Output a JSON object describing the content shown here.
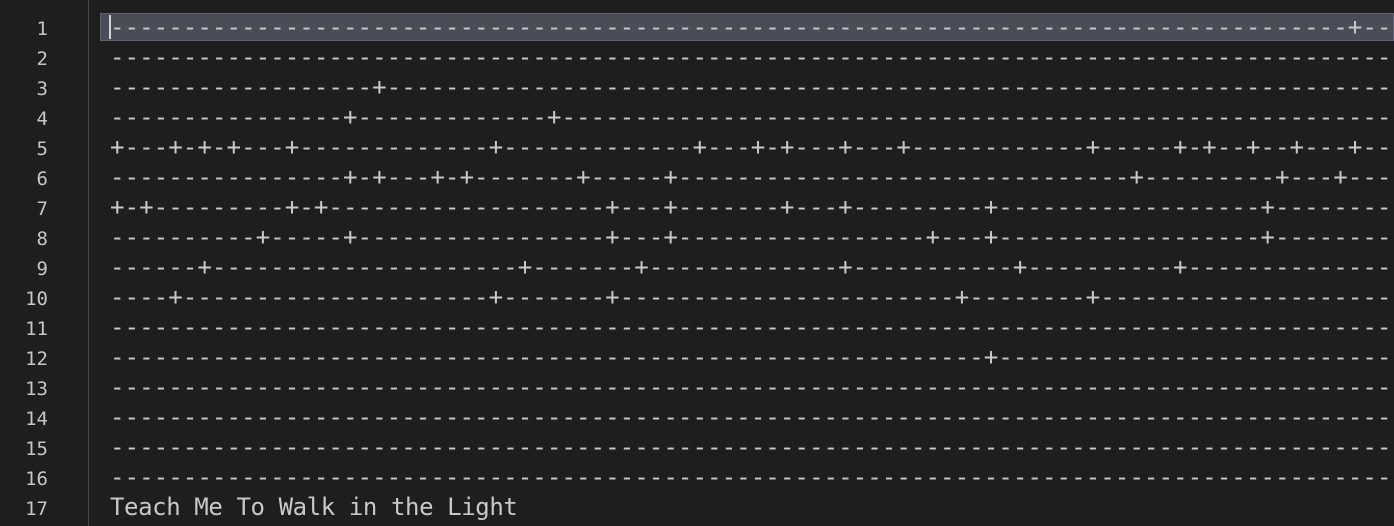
{
  "editor": {
    "line_numbers": [
      "1",
      "2",
      "3",
      "4",
      "5",
      "6",
      "7",
      "8",
      "9",
      "10",
      "11",
      "12",
      "13",
      "14",
      "15",
      "16",
      "17"
    ],
    "lines": [
      "-------------------------------------------------------------------------------------+--",
      "----------------------------------------------------------------------------------------",
      "------------------+----------------------------------------------------------------------",
      "----------------+-------------+---------------------------------------------------------",
      "+---+-+-+---+-------------+-------------+---+-+---+---+------------+-----+-+--+--+---+--",
      "----------------+-+---+-+-------+-----+-------------------------------+---------+---+---",
      "+-+---------+-+-------------------+---+-------+---+---------+------------------+--------",
      "----------+-----+-----------------+---+-----------------+---+------------------+--------",
      "------+---------------------+-------+-------------+-----------+----------+--------------",
      "----+---------------------+-------+-----------------------+--------+--------------------",
      "----------------------------------------------------------------------------------------",
      "------------------------------------------------------------+---------------------------",
      "----------------------------------------------------------------------------------------",
      "----------------------------------------------------------------------------------------",
      "----------------------------------------------------------------------------------------",
      "----------------------------------------------------------------------------------------",
      "Teach Me To Walk in the Light"
    ]
  }
}
